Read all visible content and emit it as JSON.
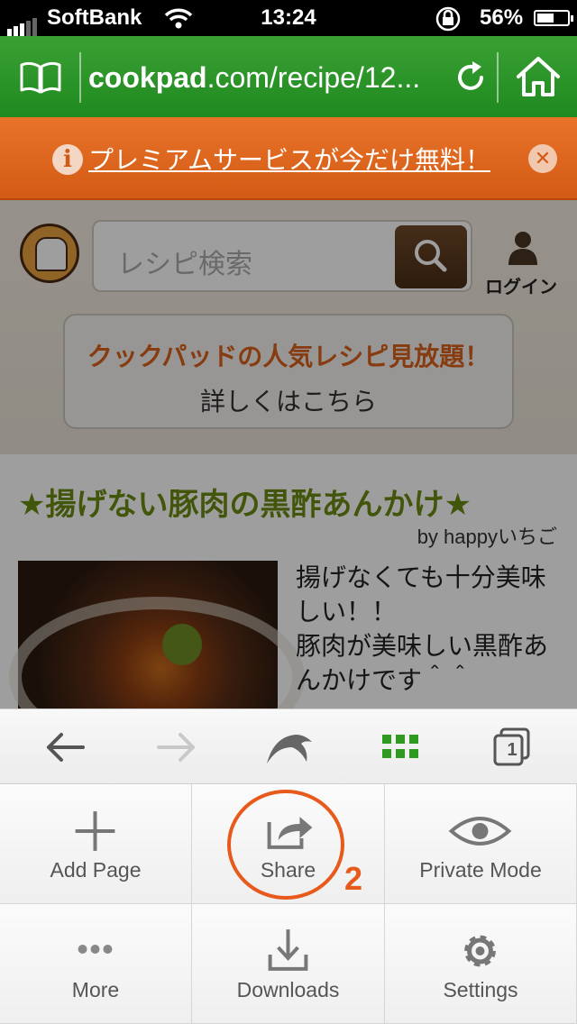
{
  "status_bar": {
    "carrier": "SoftBank",
    "time": "13:24",
    "battery": "56%",
    "battery_level": 0.56
  },
  "address_bar": {
    "url_domain": "cookpad",
    "url_rest": ".com/recipe/12..."
  },
  "promo_banner": {
    "info_glyph": "i",
    "text": "プレミアムサービスが今だけ無料！",
    "close_glyph": "✕"
  },
  "site_header": {
    "search_placeholder": "レシピ検索",
    "login_label": "ログイン"
  },
  "ad_box": {
    "line1": "クックパッドの人気レシピ見放題！",
    "line2": "詳しくはこちら"
  },
  "recipe": {
    "title": "★揚げない豚肉の黒酢あんかけ★",
    "by_prefix": "by ",
    "author": "happyいちご",
    "description": "揚げなくても十分美味しい！！\n豚肉が美味しい黒酢あんかけです＾＾"
  },
  "toolbar": {
    "tabs_count": "1"
  },
  "menu": {
    "add_page": "Add Page",
    "share": "Share",
    "private_mode": "Private Mode",
    "more": "More",
    "downloads": "Downloads",
    "settings": "Settings"
  },
  "annotation": {
    "step_number": "2"
  },
  "colors": {
    "accent_green": "#1f8a20",
    "banner_orange": "#e9732a",
    "annotation_red": "#e85a1c"
  }
}
